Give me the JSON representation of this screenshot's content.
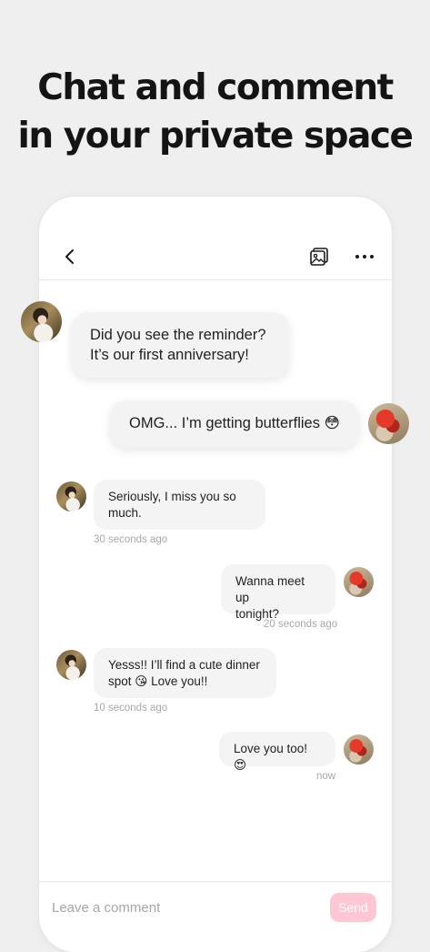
{
  "headline": {
    "line1": "Chat and comment",
    "line2": "in your private space"
  },
  "topbar": {
    "back_icon": "chevron-left-icon",
    "gallery_icon": "image-gallery-icon",
    "more_icon": "more-dots-icon"
  },
  "messages": [
    {
      "sender": "her",
      "text": "Did you see the reminder?\nIt’s our first anniversary!",
      "timestamp": ""
    },
    {
      "sender": "him",
      "text": "OMG... I’m getting butterflies 😳",
      "timestamp": ""
    },
    {
      "sender": "her",
      "text": "Seriously, I miss you so\nmuch.",
      "timestamp": "30 seconds ago"
    },
    {
      "sender": "him",
      "text": "Wanna meet up\ntonight?",
      "timestamp": "20 seconds ago"
    },
    {
      "sender": "her",
      "text": "Yesss!! I’ll find a cute dinner\nspot 😘 Love you!!",
      "timestamp": "10 seconds ago"
    },
    {
      "sender": "him",
      "text": "Love you too! 😍",
      "timestamp": "now"
    }
  ],
  "comment": {
    "placeholder": "Leave a comment",
    "send_label": "Send"
  },
  "colors": {
    "background": "#efefef",
    "bubble": "#f4f4f4",
    "send_button": "#ffc7d4",
    "timestamp": "#a8a8a8"
  }
}
